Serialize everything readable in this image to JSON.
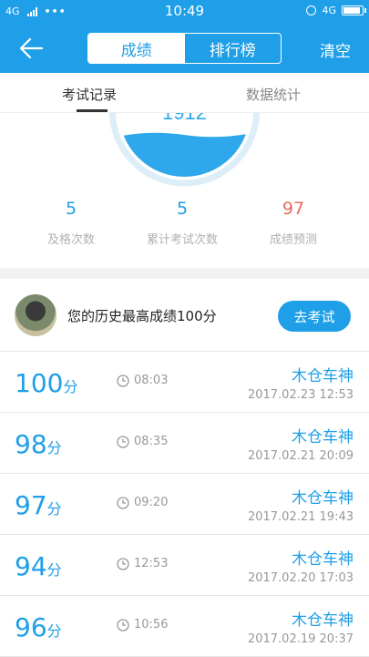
{
  "status_bar": {
    "network": "4G",
    "time": "10:49",
    "network_right": "4G"
  },
  "header": {
    "seg_active": "成绩",
    "seg_inactive": "排行榜",
    "clear_label": "清空"
  },
  "tabs": {
    "tab1": "考试记录",
    "tab2": "数据统计"
  },
  "gauge": {
    "value": "1912"
  },
  "stats": [
    {
      "value": "5",
      "label": "及格次数"
    },
    {
      "value": "5",
      "label": "累计考试次数"
    },
    {
      "value": "97",
      "label": "成绩预测"
    }
  ],
  "profile": {
    "text": "您的历史最高成绩100分",
    "button": "去考试"
  },
  "records": [
    {
      "score": "100",
      "unit": "分",
      "duration": "08:03",
      "name": "木仓车神",
      "date": "2017.02.23  12:53"
    },
    {
      "score": "98",
      "unit": "分",
      "duration": "08:35",
      "name": "木仓车神",
      "date": "2017.02.21  20:09"
    },
    {
      "score": "97",
      "unit": "分",
      "duration": "09:20",
      "name": "木仓车神",
      "date": "2017.02.21  19:43"
    },
    {
      "score": "94",
      "unit": "分",
      "duration": "12:53",
      "name": "木仓车神",
      "date": "2017.02.20  17:03"
    },
    {
      "score": "96",
      "unit": "分",
      "duration": "10:56",
      "name": "木仓车神",
      "date": "2017.02.19  20:37"
    }
  ],
  "icons": {
    "back": "back-arrow-icon",
    "clock": "clock-icon",
    "alarm": "alarm-icon",
    "battery": "battery-icon",
    "signal": "signal-icon"
  },
  "colors": {
    "accent": "#1e9fe8",
    "prediction": "#e46c5c"
  }
}
